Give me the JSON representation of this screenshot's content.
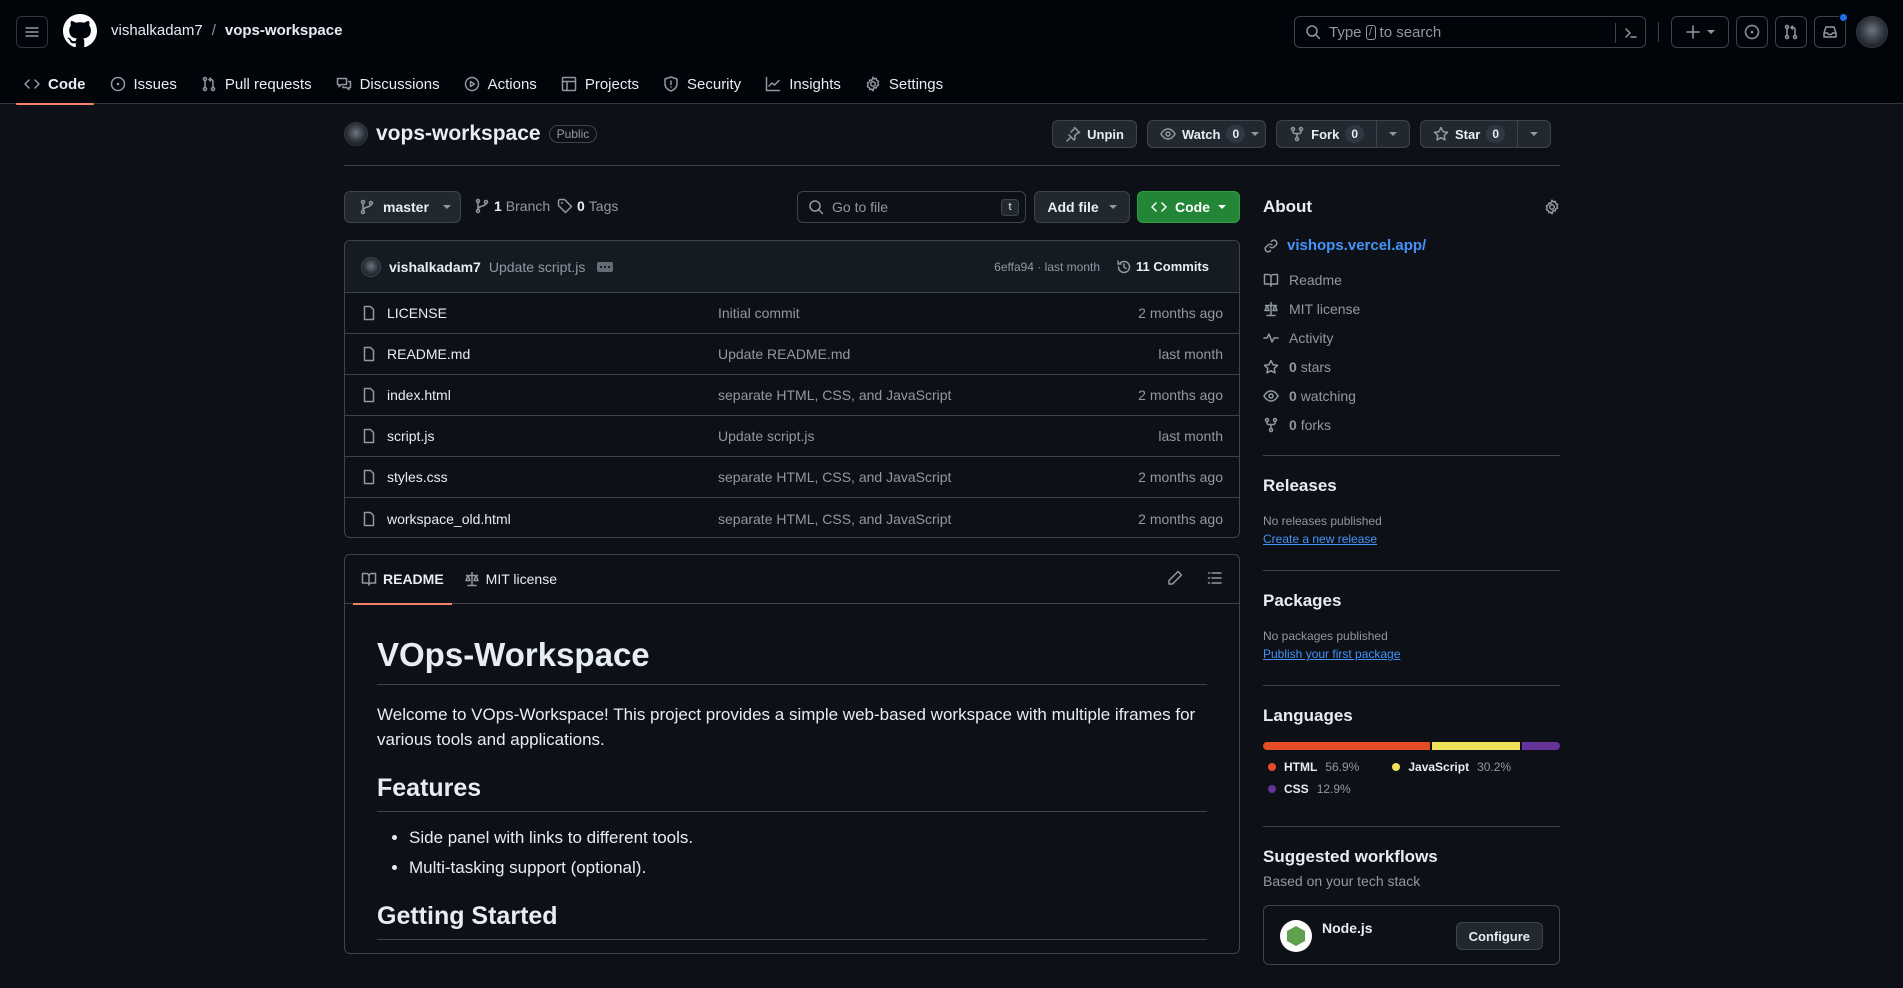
{
  "header": {
    "owner": "vishalkadam7",
    "separator": "/",
    "repo": "vops-workspace",
    "search": {
      "prefix": "Type",
      "key": "/",
      "suffix": "to search"
    },
    "has_notification": true
  },
  "repo_nav": [
    {
      "label": "Code",
      "icon": "code-icon",
      "active": true
    },
    {
      "label": "Issues",
      "icon": "issue-icon"
    },
    {
      "label": "Pull requests",
      "icon": "pull-request-icon"
    },
    {
      "label": "Discussions",
      "icon": "discussion-icon"
    },
    {
      "label": "Actions",
      "icon": "play-icon"
    },
    {
      "label": "Projects",
      "icon": "table-icon"
    },
    {
      "label": "Security",
      "icon": "shield-icon"
    },
    {
      "label": "Insights",
      "icon": "graph-icon"
    },
    {
      "label": "Settings",
      "icon": "gear-icon"
    }
  ],
  "repo_title": {
    "name": "vops-workspace",
    "visibility": "Public"
  },
  "repo_actions": {
    "unpin": "Unpin",
    "watch": {
      "label": "Watch",
      "count": "0"
    },
    "fork": {
      "label": "Fork",
      "count": "0"
    },
    "star": {
      "label": "Star",
      "count": "0"
    }
  },
  "toolbar": {
    "branch": "master",
    "branches": {
      "count": "1",
      "label": "Branch"
    },
    "tags": {
      "count": "0",
      "label": "Tags"
    },
    "goto_placeholder": "Go to file",
    "goto_key": "t",
    "add_file": "Add file",
    "code": "Code"
  },
  "latest_commit": {
    "author": "vishalkadam7",
    "message": "Update script.js",
    "hash": "6effa94",
    "time": "last month",
    "hash_time_sep": " · ",
    "commits_count": "11 Commits"
  },
  "files": [
    {
      "name": "LICENSE",
      "message": "Initial commit",
      "age": "2 months ago"
    },
    {
      "name": "README.md",
      "message": "Update README.md",
      "age": "last month"
    },
    {
      "name": "index.html",
      "message": "separate HTML, CSS, and JavaScript",
      "age": "2 months ago"
    },
    {
      "name": "script.js",
      "message": "Update script.js",
      "age": "last month"
    },
    {
      "name": "styles.css",
      "message": "separate HTML, CSS, and JavaScript",
      "age": "2 months ago"
    },
    {
      "name": "workspace_old.html",
      "message": "separate HTML, CSS, and JavaScript",
      "age": "2 months ago"
    }
  ],
  "readme": {
    "tabs": [
      {
        "label": "README",
        "active": true
      },
      {
        "label": "MIT license"
      }
    ],
    "title": "VOps-Workspace",
    "intro": "Welcome to VOps-Workspace! This project provides a simple web-based workspace with multiple iframes for various tools and applications.",
    "features_heading": "Features",
    "features": [
      "Side panel with links to different tools.",
      "Multi-tasking support (optional)."
    ],
    "getting_started_heading": "Getting Started"
  },
  "sidebar": {
    "about": {
      "heading": "About",
      "website": "vishops.vercel.app/",
      "items": [
        {
          "icon": "book-icon",
          "label": "Readme"
        },
        {
          "icon": "law-icon",
          "label": "MIT license"
        },
        {
          "icon": "pulse-icon",
          "label": "Activity"
        },
        {
          "icon": "star-icon",
          "count": "0",
          "label": "stars"
        },
        {
          "icon": "eye-icon",
          "count": "0",
          "label": "watching"
        },
        {
          "icon": "fork-icon",
          "count": "0",
          "label": "forks"
        }
      ]
    },
    "releases": {
      "heading": "Releases",
      "empty": "No releases published",
      "link": "Create a new release"
    },
    "packages": {
      "heading": "Packages",
      "empty": "No packages published",
      "link": "Publish your first package"
    },
    "languages": {
      "heading": "Languages",
      "items": [
        {
          "name": "HTML",
          "percent": 56.9,
          "label": "56.9%",
          "color": "#e34c26"
        },
        {
          "name": "JavaScript",
          "percent": 30.2,
          "label": "30.2%",
          "color": "#f1e05a"
        },
        {
          "name": "CSS",
          "percent": 12.9,
          "label": "12.9%",
          "color": "#663399"
        }
      ]
    },
    "workflows": {
      "heading": "Suggested workflows",
      "subheading": "Based on your tech stack",
      "items": [
        {
          "name": "Node.js",
          "action": "Configure"
        }
      ]
    }
  }
}
